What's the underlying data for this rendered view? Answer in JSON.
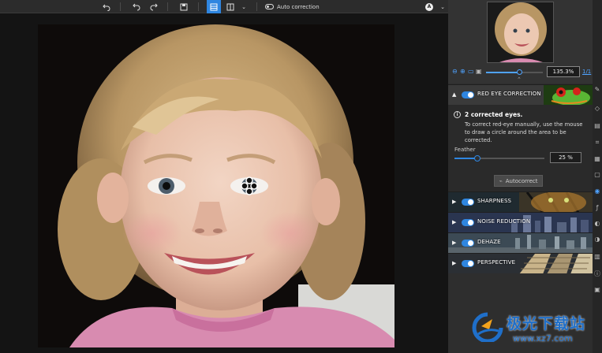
{
  "toolbar": {
    "undo_icon": "undo-icon",
    "undo2_icon": "undo-step-icon",
    "redo_icon": "redo-icon",
    "save_icon": "save-icon",
    "single_view_icon": "single-view-icon",
    "split_view_icon": "split-view-icon",
    "dropdown_icon": "chevron-down-icon",
    "auto_correction_label": "Auto correction",
    "avatar_initial": "A",
    "menu_chevron": "chevron-down-icon"
  },
  "navigator": {
    "zoom_value": "135.3%",
    "fit_label": "1/1"
  },
  "red_eye": {
    "title": "RED EYE CORRECTION",
    "info_title": "2 corrected eyes.",
    "info_text": "To correct red-eye manually, use the mouse to draw a circle around the area to be corrected.",
    "feather_label": "Feather",
    "feather_value": "25 %",
    "feather_fraction": 0.25,
    "autocorrect_label": "Autocorrect"
  },
  "panels": [
    {
      "title": "SHARPNESS"
    },
    {
      "title": "NOISE REDUCTION"
    },
    {
      "title": "DEHAZE"
    },
    {
      "title": "PERSPECTIVE"
    }
  ],
  "watermark": {
    "brand": "极光下载站",
    "url": "www.xz7.com"
  },
  "colors": {
    "accent": "#2f86e0",
    "panel_bg": "#2e2e2e",
    "toolbar_bg": "#2c2c2c"
  }
}
